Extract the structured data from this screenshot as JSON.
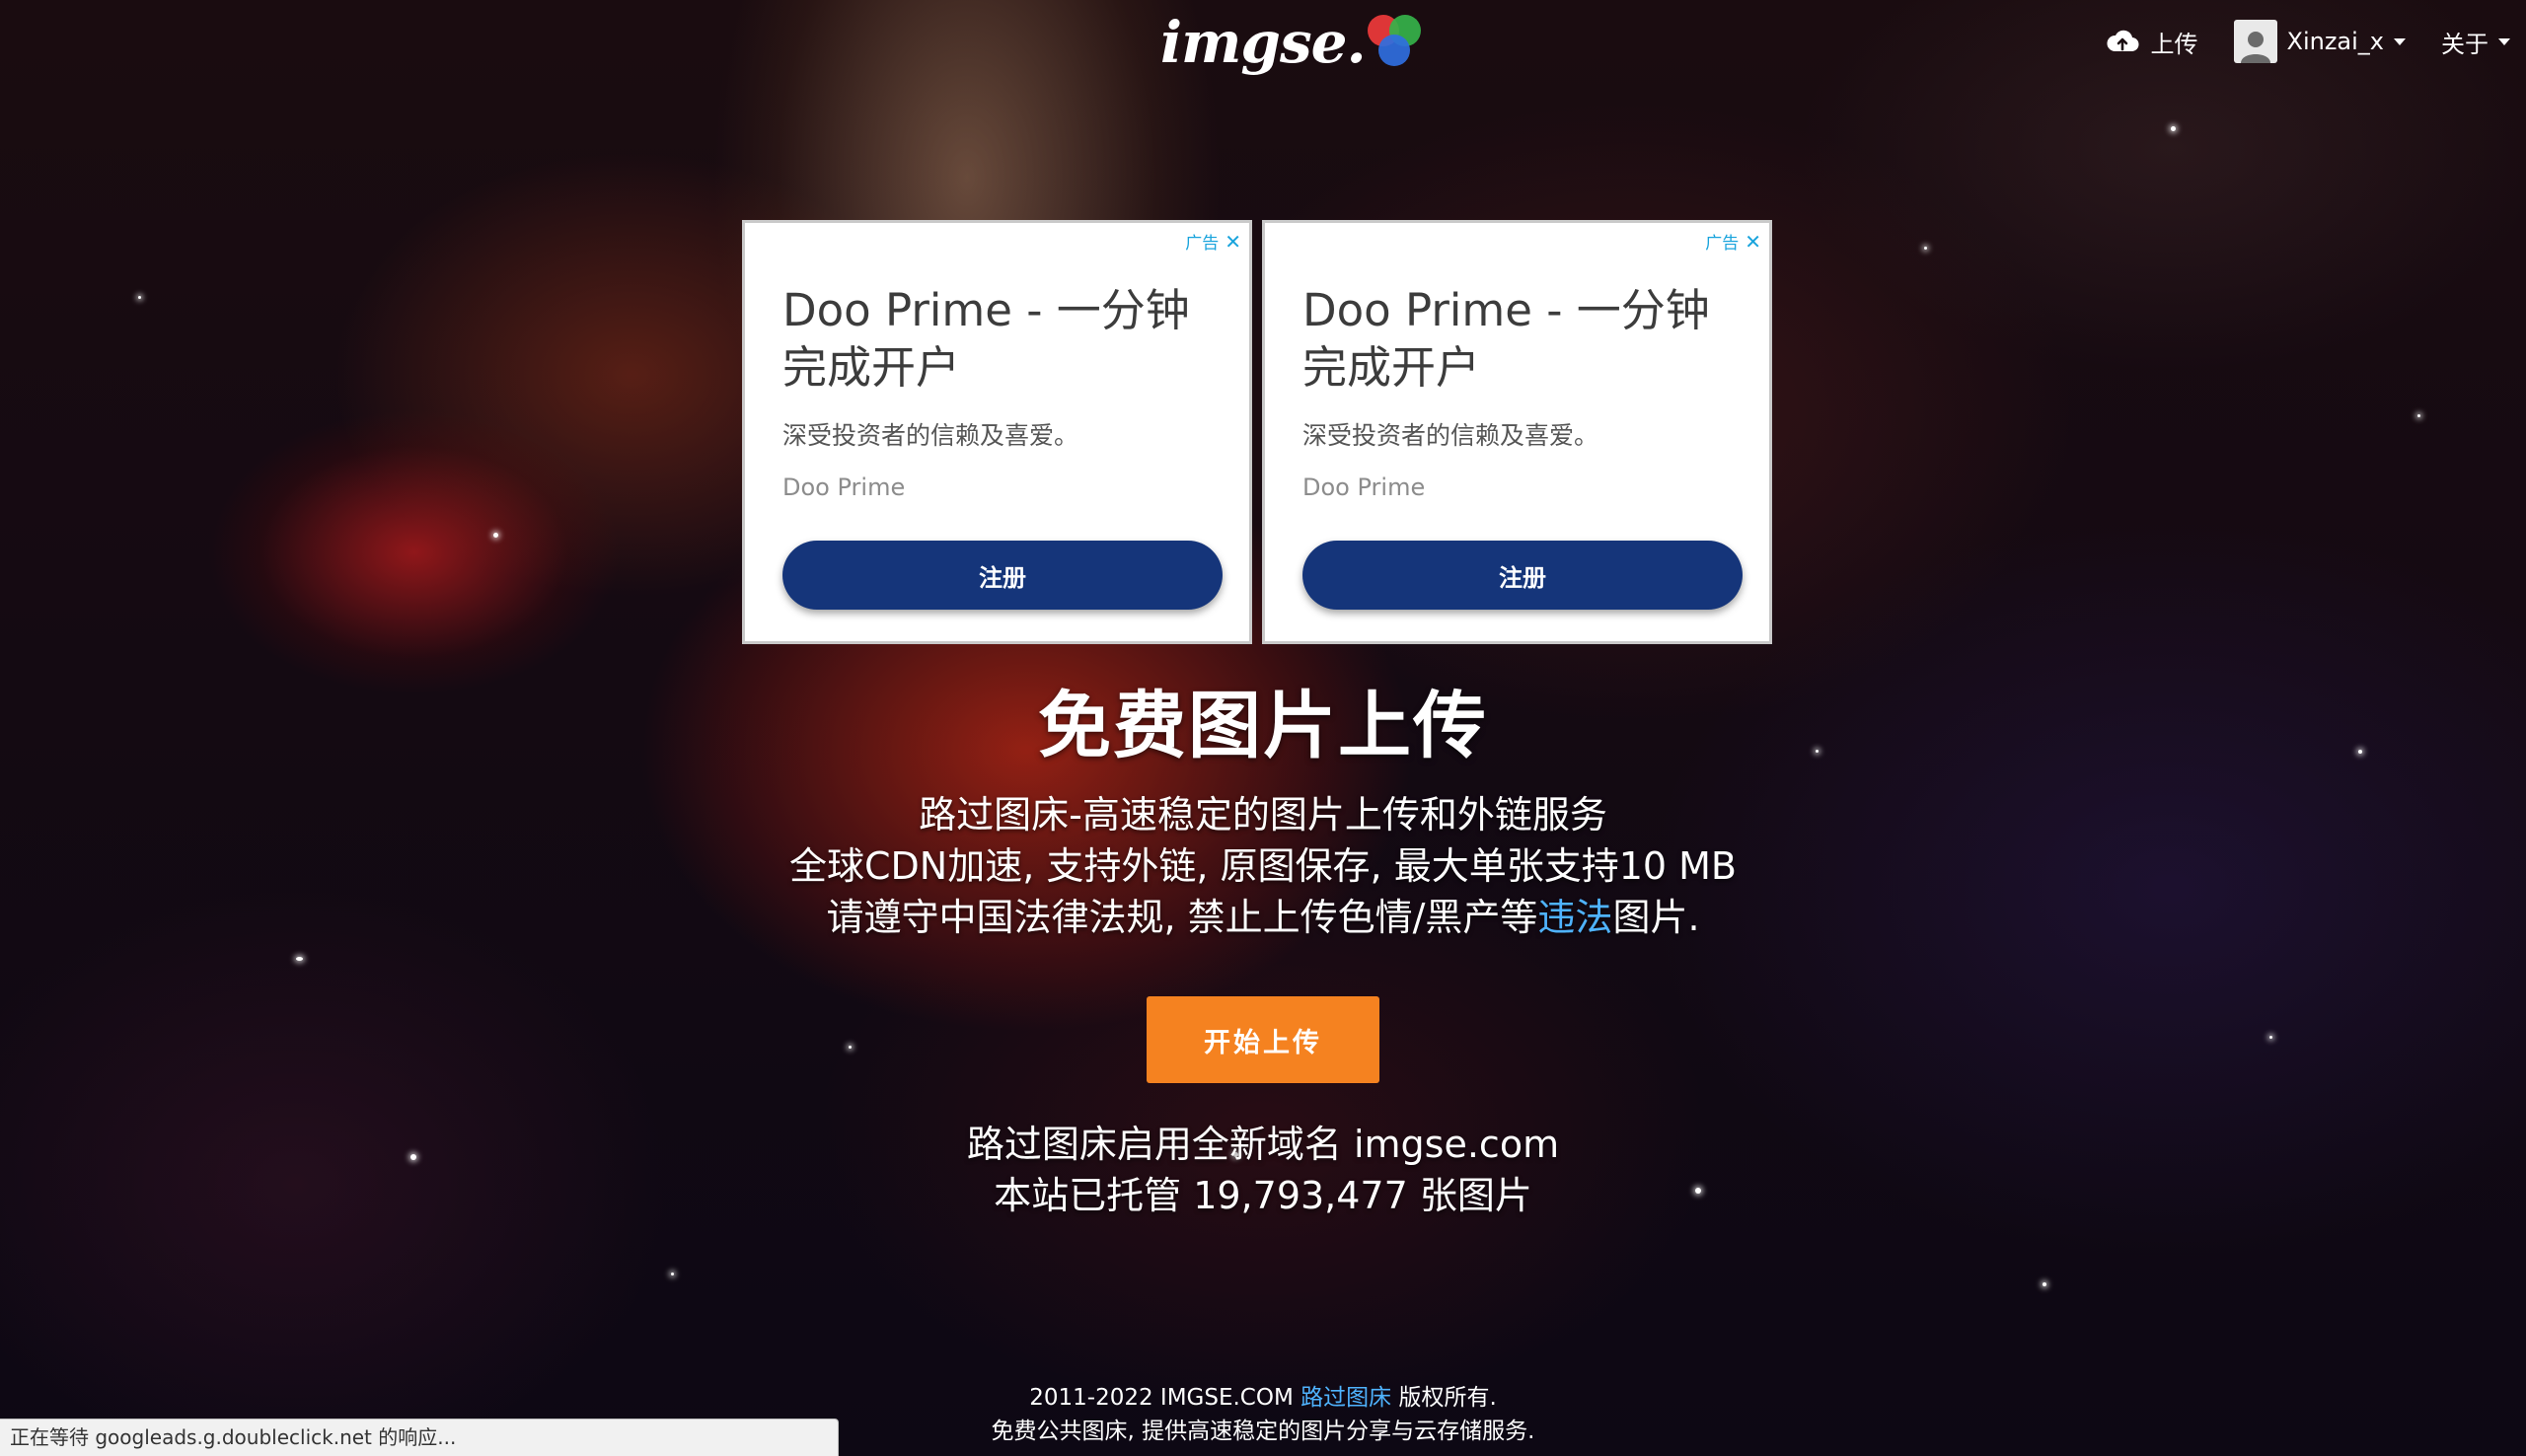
{
  "logo": {
    "text": "imgse."
  },
  "nav": {
    "upload_label": "上传",
    "upload_icon": "cloud-upload-icon",
    "user_label": "Xinzai_x",
    "user_icon": "user-avatar-icon",
    "about_label": "关于"
  },
  "ads": [
    {
      "tag": "广告",
      "title": "Doo Prime - 一分钟完成开户",
      "description": "深受投资者的信赖及喜爱。",
      "brand": "Doo Prime",
      "cta": "注册"
    },
    {
      "tag": "广告",
      "title": "Doo Prime - 一分钟完成开户",
      "description": "深受投资者的信赖及喜爱。",
      "brand": "Doo Prime",
      "cta": "注册"
    }
  ],
  "hero": {
    "headline": "免费图片上传",
    "line1": "路过图床-高速稳定的图片上传和外链服务",
    "line2": "全球CDN加速, 支持外链, 原图保存, 最大单张支持10 MB",
    "line3_pre": "请遵守中国法律法规, 禁止上传色情/黑产等",
    "line3_link": "违法",
    "line3_post": "图片.",
    "start_button": "开始上传",
    "domain_line": "路过图床启用全新域名 imgse.com",
    "hosted_line": "本站已托管 19,793,477 张图片"
  },
  "footer": {
    "copyright_pre": "2011-2022 IMGSE.COM",
    "copyright_link": "路过图床",
    "copyright_post": "版权所有.",
    "tagline": "免费公共图床, 提供高速稳定的图片分享与云存储服务."
  },
  "status_bar": {
    "text": "正在等待 googleads.g.doubleclick.net 的响应..."
  },
  "colors": {
    "accent_orange": "#f58220",
    "link_blue": "#4fb3ff",
    "ad_cta_navy": "#15357a",
    "ad_tag_blue": "#17a3dc"
  }
}
